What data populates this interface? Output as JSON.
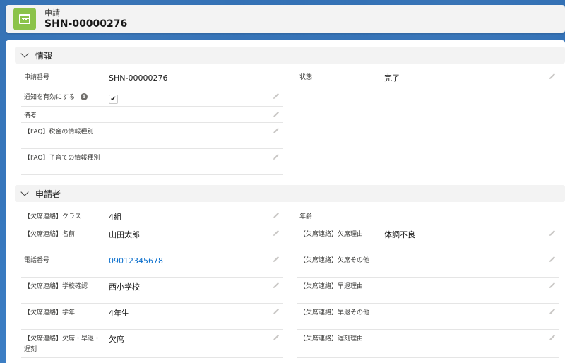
{
  "header": {
    "object_label": "申請",
    "record_name": "SHN-00000276"
  },
  "sections": {
    "info": {
      "title": "情報",
      "fields": {
        "app_number": {
          "label": "申請番号",
          "value": "SHN-00000276"
        },
        "notify": {
          "label": "通知を有効にする",
          "checked": "✔"
        },
        "remarks": {
          "label": "備考",
          "value": ""
        },
        "faq_tax": {
          "label": "【FAQ】税金の情報種別",
          "value": ""
        },
        "faq_child": {
          "label": "【FAQ】子育ての情報種別",
          "value": ""
        },
        "status": {
          "label": "状態",
          "value": "完了"
        }
      }
    },
    "applicant": {
      "title": "申請者",
      "fields": {
        "klass": {
          "label": "【欠席連絡】クラス",
          "value": "4組"
        },
        "name": {
          "label": "【欠席連絡】名前",
          "value": "山田太郎"
        },
        "phone": {
          "label": "電話番号",
          "value": "09012345678"
        },
        "school": {
          "label": "【欠席連絡】学校確認",
          "value": "西小学校"
        },
        "grade": {
          "label": "【欠席連絡】学年",
          "value": "4年生"
        },
        "type": {
          "label": "【欠席連絡】欠席・早退・遅刻",
          "value": "欠席"
        },
        "age": {
          "label": "年齢",
          "value": ""
        },
        "absence_reason": {
          "label": "【欠席連絡】欠席理由",
          "value": "体調不良"
        },
        "absence_other": {
          "label": "【欠席連絡】欠席その他",
          "value": ""
        },
        "early_reason": {
          "label": "【欠席連絡】早退理由",
          "value": ""
        },
        "early_other": {
          "label": "【欠席連絡】早退その他",
          "value": ""
        },
        "late_reason": {
          "label": "【欠席連絡】遅刻理由",
          "value": ""
        }
      }
    }
  },
  "icons": {
    "object": "application-icon",
    "edit": "pencil-icon",
    "info": "info-icon",
    "collapse": "chevron-down-icon"
  },
  "colors": {
    "background": "#2f6fb5",
    "object_icon": "#8bc34a",
    "link": "#0b6fcc"
  }
}
